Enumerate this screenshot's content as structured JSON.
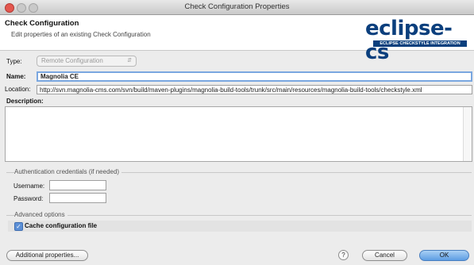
{
  "window": {
    "title": "Check Configuration Properties"
  },
  "header": {
    "title": "Check Configuration",
    "description": "Edit properties of an existing Check Configuration",
    "logo_main": "eclipse-cs",
    "logo_sub": "ECLIPSE CHECKSTYLE INTEGRATION"
  },
  "form": {
    "type_label": "Type:",
    "type_value": "Remote Configuration",
    "name_label": "Name:",
    "name_value": "Magnolia CE",
    "location_label": "Location:",
    "location_value": "http://svn.magnolia-cms.com/svn/build/maven-plugins/magnolia-build-tools/trunk/src/main/resources/magnolia-build-tools/checkstyle.xml",
    "description_label": "Description:",
    "description_value": ""
  },
  "auth": {
    "section_label": "Authentication credentials (if needed)",
    "username_label": "Username:",
    "username_value": "",
    "password_label": "Password:",
    "password_value": ""
  },
  "advanced": {
    "section_label": "Advanced options",
    "cache_label": "Cache configuration file",
    "cache_checked": true
  },
  "buttons": {
    "additional": "Additional properties...",
    "help": "?",
    "cancel": "Cancel",
    "ok": "OK"
  }
}
